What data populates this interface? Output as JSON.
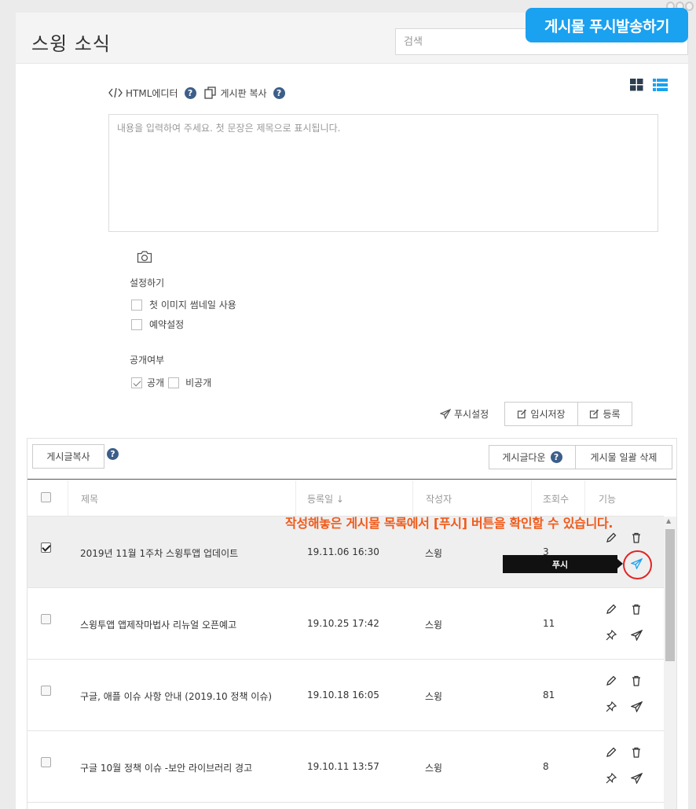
{
  "page": {
    "title": "스윙 소식"
  },
  "search": {
    "placeholder": "검색"
  },
  "banner": {
    "text": "게시물 푸시발송하기"
  },
  "toolbar": {
    "html_editor": "HTML에디터",
    "copy_board": "게시판 복사"
  },
  "editor": {
    "placeholder": "내용을 입력하여 주세요. 첫 문장은 제목으로 표시됩니다."
  },
  "settings": {
    "title": "설정하기",
    "thumbnail": "첫 이미지 썸네일 사용",
    "reserve": "예약설정"
  },
  "visibility": {
    "title": "공개여부",
    "public": "공개",
    "private": "비공개"
  },
  "actions": {
    "push_settings": "푸시설정",
    "temp_save": "임시저장",
    "register": "등록"
  },
  "list": {
    "copy_button": "게시글복사",
    "download_button": "게시글다운",
    "bulk_delete_button": "게시물 일괄 삭제",
    "columns": {
      "title": "제목",
      "date": "등록일 ↓",
      "author": "작성자",
      "views": "조회수",
      "functions": "기능"
    },
    "rows": [
      {
        "checked": true,
        "title": "2019년 11월 1주차 스윙투앱 업데이트",
        "date": "19.11.06 16:30",
        "author": "스윙",
        "views": "3"
      },
      {
        "checked": false,
        "title": "스윙투앱 앱제작마법사 리뉴얼 오픈예고",
        "date": "19.10.25 17:42",
        "author": "스윙",
        "views": "11"
      },
      {
        "checked": false,
        "title": "구글, 애플 이슈 사항 안내 (2019.10 정책 이슈)",
        "date": "19.10.18 16:05",
        "author": "스윙",
        "views": "81"
      },
      {
        "checked": false,
        "title": "구글 10월 정책 이슈 -보안 라이브러리 경고",
        "date": "19.10.11 13:57",
        "author": "스윙",
        "views": "8"
      }
    ]
  },
  "annotation": {
    "text": "작성해놓은 게시물 목록에서 [푸시] 버튼을 확인할 수 있습니다."
  },
  "tooltip": {
    "text": "푸시"
  },
  "colors": {
    "accent": "#1aa1f0",
    "annotation": "#f05a1a",
    "highlight": "#e32424",
    "help": "#3d5e8a"
  }
}
